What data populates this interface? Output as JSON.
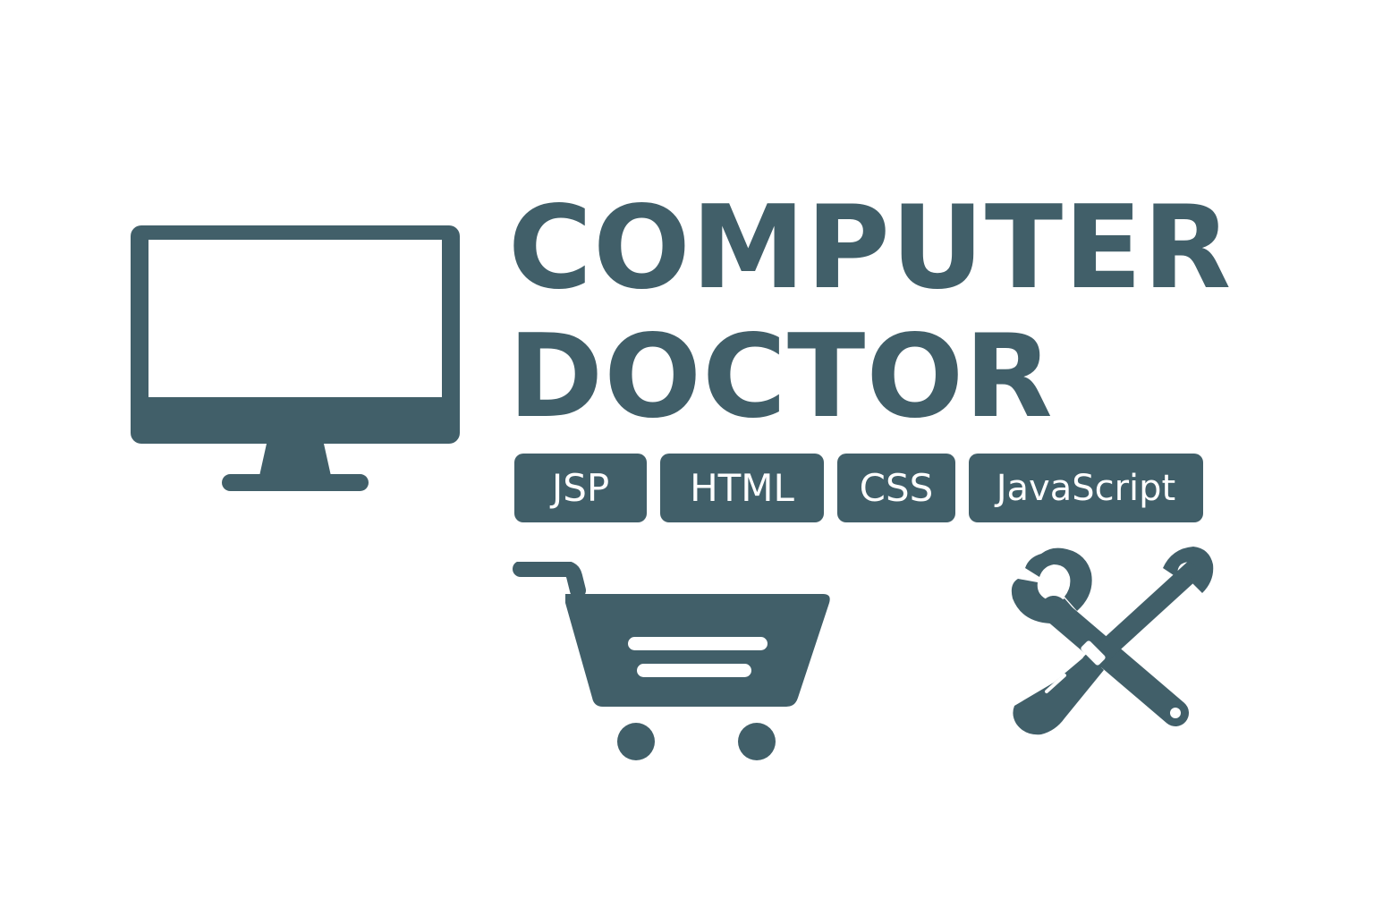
{
  "brand": {
    "title_line_1": "COMPUTER",
    "title_line_2": "DOCTOR",
    "color": "#415f69",
    "background": "#ffffff"
  },
  "tags": [
    "JSP",
    "HTML",
    "CSS",
    "JavaScript"
  ],
  "icons": {
    "monitor": "monitor-icon",
    "cart": "shopping-cart-icon",
    "tools": "wrench-screwdriver-icon"
  }
}
